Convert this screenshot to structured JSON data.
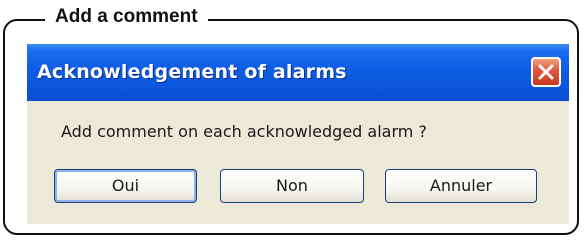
{
  "frame": {
    "title": "Add a comment"
  },
  "dialog": {
    "title": "Acknowledgement of alarms",
    "message": "Add comment on each acknowledged alarm ?",
    "close_icon": "close-icon",
    "buttons": {
      "yes_label": "Oui",
      "no_label": "Non",
      "cancel_label": "Annuler"
    }
  },
  "colors": {
    "titlebar": "#0b56dc",
    "close_button": "#e2563a",
    "dialog_body": "#ece9d8",
    "frame_border": "#111111"
  }
}
